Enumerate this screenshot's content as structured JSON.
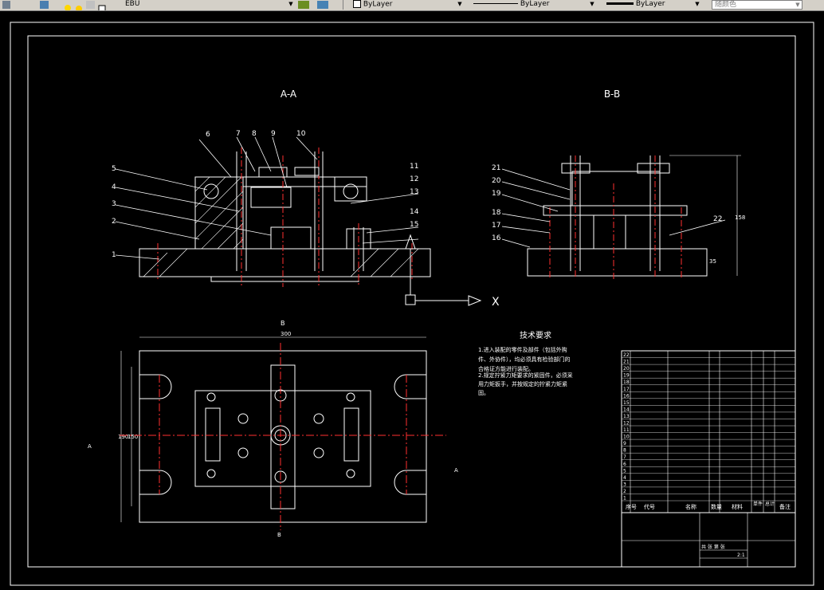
{
  "toolbar": {
    "layer_name": "EBU",
    "color": "ByLayer",
    "linetype": "ByLayer",
    "lineweight": "ByLayer",
    "plotstyle": "随颜色"
  },
  "drawing": {
    "section_aa_title": "A-A",
    "section_bb_title": "B-B",
    "top_view_title": "B",
    "view_label_a_left": "A",
    "view_label_a_right": "A",
    "view_label_b_bottom": "B",
    "dim_width": "300",
    "dim_height": "190",
    "dim_height_inner": "150",
    "dim_bb_height": "158",
    "dim_bb_base": "35",
    "balloons_left": [
      "6",
      "5",
      "4",
      "3",
      "2",
      "1"
    ],
    "balloons_top": [
      "7",
      "8",
      "9",
      "10"
    ],
    "balloons_right": [
      "11",
      "12",
      "13",
      "14",
      "15"
    ],
    "balloons_bb_left": [
      "21",
      "20",
      "19",
      "18",
      "17",
      "16"
    ],
    "balloon_bb_right": "22",
    "ucs_x": "X",
    "tech_title": "技术要求",
    "tech_lines": [
      "1.进入装配的零件及部件（包括外购",
      "件、外协件），均必须具有检验部门的",
      "合格证方能进行装配。",
      "2.规定拧紧力矩要求的紧固件，必须采",
      "用力矩扳手，并按规定的拧紧力矩紧",
      "固。"
    ]
  },
  "title_block": {
    "header": [
      "序号",
      "代号",
      "名称",
      "数量",
      "材料",
      "单件",
      "总计",
      "备注"
    ],
    "rows": [
      "22",
      "21",
      "20",
      "19",
      "18",
      "17",
      "16",
      "15",
      "14",
      "13",
      "12",
      "11",
      "10",
      "9",
      "8",
      "7",
      "6",
      "5",
      "4",
      "3",
      "2",
      "1"
    ],
    "sheet_label": "共 张 第 张",
    "scale": "2:1"
  }
}
